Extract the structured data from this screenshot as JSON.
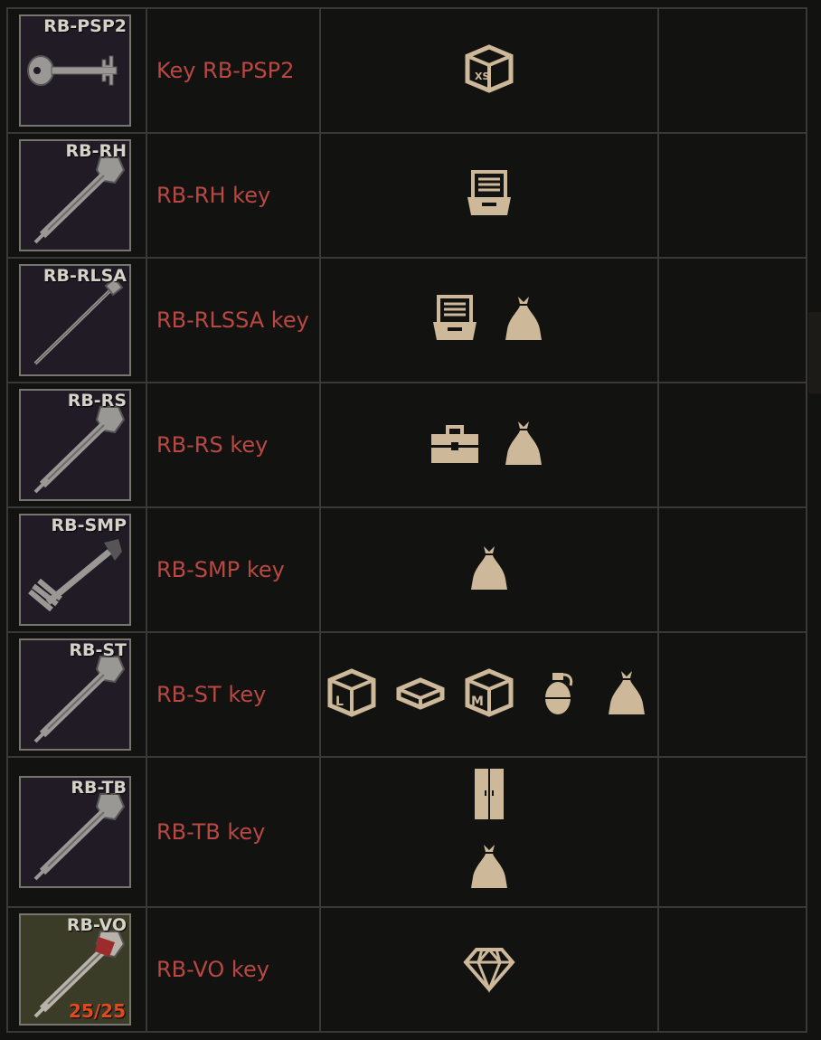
{
  "rows": [
    {
      "code": "RB-PSP2",
      "name": "Key RB-PSP2",
      "icons": [
        "box-xs-icon"
      ]
    },
    {
      "code": "RB-RH",
      "name": "RB-RH key",
      "icons": [
        "filing-drawer-icon"
      ]
    },
    {
      "code": "RB-RLSA",
      "name": "RB-RLSSA key",
      "icons": [
        "filing-drawer-icon",
        "sack-icon"
      ]
    },
    {
      "code": "RB-RS",
      "name": "RB-RS key",
      "icons": [
        "toolbox-icon",
        "sack-icon"
      ]
    },
    {
      "code": "RB-SMP",
      "name": "RB-SMP key",
      "icons": [
        "sack-icon"
      ]
    },
    {
      "code": "RB-ST",
      "name": "RB-ST key",
      "icons": [
        "box-l-icon",
        "flat-case-icon",
        "box-m-icon",
        "grenade-icon",
        "sack-icon"
      ]
    },
    {
      "code": "RB-TB",
      "name": "RB-TB key",
      "icons": [
        "cabinet-icon",
        "sack-icon"
      ]
    },
    {
      "code": "RB-VO",
      "name": "RB-VO key",
      "count": "25/25",
      "icons": [
        "diamond-icon"
      ]
    }
  ],
  "colors": {
    "name": "#b94843",
    "icon": "#cdb99a",
    "border": "#3a3935",
    "count": "#e24a1c"
  }
}
